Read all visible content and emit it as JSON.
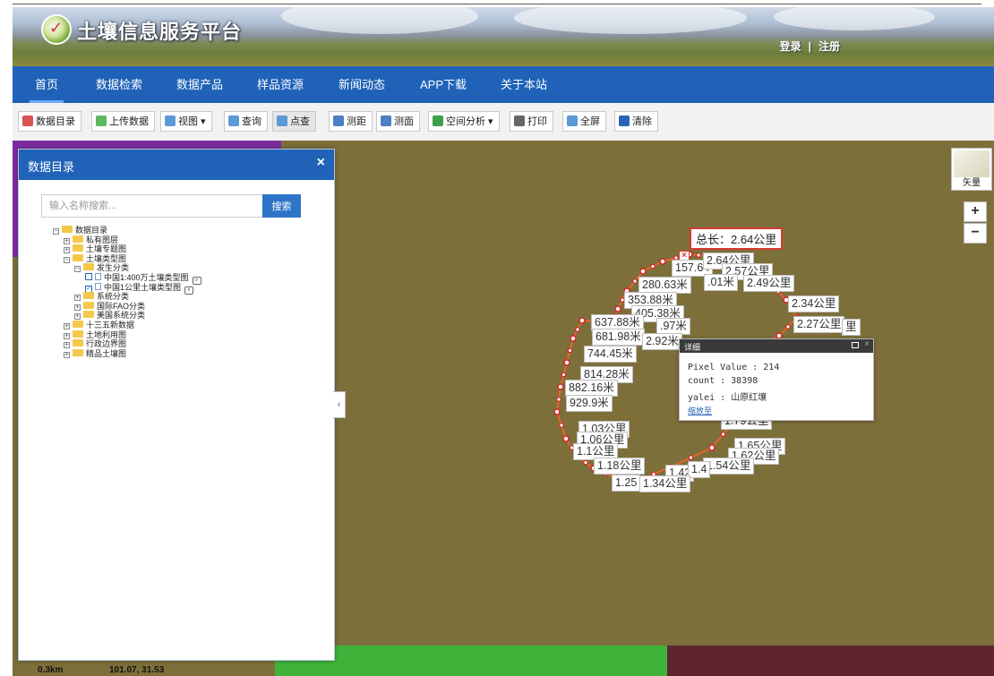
{
  "header": {
    "site_title": "土壤信息服务平台",
    "login": "登录",
    "separator": "|",
    "register": "注册"
  },
  "nav": {
    "items": [
      {
        "label": "首页",
        "active": true
      },
      {
        "label": "数据检索"
      },
      {
        "label": "数据产品"
      },
      {
        "label": "样品资源"
      },
      {
        "label": "新闻动态"
      },
      {
        "label": "APP下载"
      },
      {
        "label": "关于本站"
      }
    ]
  },
  "toolbar": {
    "buttons": [
      {
        "label": "数据目录",
        "icon": "catalog-icon",
        "color": "#d9534f"
      },
      {
        "label": "上传数据",
        "icon": "upload-icon",
        "color": "#5cb85c"
      },
      {
        "label": "视图 ▾",
        "icon": "view-icon",
        "color": "#5b9bd5"
      },
      {
        "label": "查询",
        "icon": "query-icon",
        "color": "#5b9bd5"
      },
      {
        "label": "点查",
        "icon": "point-query-icon",
        "color": "#5b9bd5"
      },
      {
        "label": "测距",
        "icon": "ruler-icon",
        "color": "#4c7fc4"
      },
      {
        "label": "测面",
        "icon": "area-icon",
        "color": "#4c7fc4"
      },
      {
        "label": "空间分析 ▾",
        "icon": "analysis-icon",
        "color": "#3ea04a"
      },
      {
        "label": "打印",
        "icon": "print-icon",
        "color": "#666666"
      },
      {
        "label": "全屏",
        "icon": "fullscreen-icon",
        "color": "#5b9bd5"
      },
      {
        "label": "清除",
        "icon": "clear-icon",
        "color": "#2a64b5"
      }
    ]
  },
  "panel": {
    "title": "数据目录",
    "close": "×",
    "search_placeholder": "输入名称搜索...",
    "search_button": "搜索",
    "tree": [
      {
        "label": "数据目录",
        "level": 0,
        "toggle": "−",
        "folder": true
      },
      {
        "label": "私有图层",
        "level": 1,
        "toggle": "+",
        "folder": true
      },
      {
        "label": "土壤专题图",
        "level": 1,
        "toggle": "+",
        "folder": true
      },
      {
        "label": "土壤类型图",
        "level": 1,
        "toggle": "−",
        "folder": true
      },
      {
        "label": "发生分类",
        "level": 2,
        "toggle": "−",
        "folder": true
      },
      {
        "label": "中国1:400万土壤类型图",
        "level": 3,
        "checkbox": false,
        "layer": true
      },
      {
        "label": "中国1公里土壤类型图",
        "level": 3,
        "checkbox": true,
        "layer": true
      },
      {
        "label": "系统分类",
        "level": 2,
        "toggle": "+",
        "folder": true
      },
      {
        "label": "国际FAO分类",
        "level": 2,
        "toggle": "+",
        "folder": true
      },
      {
        "label": "美国系统分类",
        "level": 2,
        "toggle": "+",
        "folder": true
      },
      {
        "label": "十三五新数据",
        "level": 1,
        "toggle": "+",
        "folder": true
      },
      {
        "label": "土地利用图",
        "level": 1,
        "toggle": "+",
        "folder": true
      },
      {
        "label": "行政边界图",
        "level": 1,
        "toggle": "+",
        "folder": true
      },
      {
        "label": "精品土壤图",
        "level": 1,
        "toggle": "+",
        "folder": true
      }
    ]
  },
  "map": {
    "basemap_label": "矢量",
    "zoom_in": "+",
    "zoom_out": "−",
    "scale": "0.3km",
    "coords": "101.07, 31.53",
    "total_length": "总长：2.64公里",
    "segment_labels": [
      "2.64公里",
      "157.64",
      "2.57公里",
      "2.49公里",
      ".01米",
      "280.63米",
      "2.34公里",
      "353.88米",
      "2.27公里",
      "里",
      "405.38米",
      "637.88米",
      ".97米",
      "681.98米",
      "2.92米",
      "744.45米",
      "814.28米",
      "882.16米",
      "929.9米",
      "1.79公里",
      "1.03公里",
      "1.06公里",
      "1.65公里",
      "1.1公里",
      "1.62公里",
      "1.18公里",
      "1.54公里",
      "1.42",
      "1.4",
      "1.25",
      "1.34公里"
    ]
  },
  "popup": {
    "title": "详细",
    "pixel_value": "Pixel Value : 214",
    "count": "count : 38398",
    "yalei": "yalei : 山原红壤",
    "link": "缩放至"
  }
}
